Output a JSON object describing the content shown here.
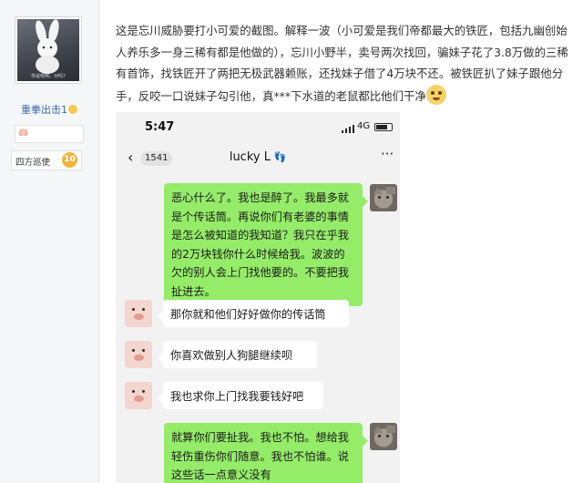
{
  "sidebar": {
    "avatar_caption": "你说呢啊，对吗?",
    "username": "重拳出击1",
    "rank_title": "四方巡使",
    "rank_level": "10"
  },
  "post": {
    "text": "这是忘川威胁要打小可爱的截图。解释一波（小可爱是我们帝都最大的铁匠，包括九幽创始人养乐多一身三稀有都是他做的），忘川小野半，卖号两次找回，骗妹子花了3.8万做的三稀有首饰，找铁匠开了两把无极武器赖账，还找妹子借了4万块不还。被铁匠扒了妹子跟他分手，反咬一口说妹子勾引他，真***下水道的老鼠都比他们干净"
  },
  "screenshot": {
    "status": {
      "time": "5:47",
      "network": "4G"
    },
    "navbar": {
      "unread_count": "1541",
      "chat_title": "lucky L",
      "title_icon": "footprints-icon"
    },
    "messages": [
      {
        "side": "me",
        "avatar": "cat-avatar",
        "text": "恶心什么了。我也是醉了。我最多就是个传话筒。再说你们有老婆的事情是怎么被知道的我知道？我只在乎我的2万块钱你什么时候给我。波波的欠的别人会上门找他要的。不要把我扯进去。"
      },
      {
        "side": "other",
        "avatar": "pig-avatar",
        "text": "那你就和他们好好做你的传话筒"
      },
      {
        "side": "other",
        "avatar": "pig-avatar",
        "text": "你喜欢做别人狗腿继续呗"
      },
      {
        "side": "other",
        "avatar": "pig-avatar",
        "text": "我也求你上门找我要钱好吧"
      },
      {
        "side": "me",
        "avatar": "cat-avatar",
        "text": "就算你们要扯我。我也不怕。想给我轻伤重伤你们随意。我也不怕谁。说这些话一点意义没有"
      }
    ]
  },
  "colors": {
    "link": "#3a6aa6",
    "wechat_green": "#95ec69",
    "chat_bg": "#f2f2f2"
  }
}
